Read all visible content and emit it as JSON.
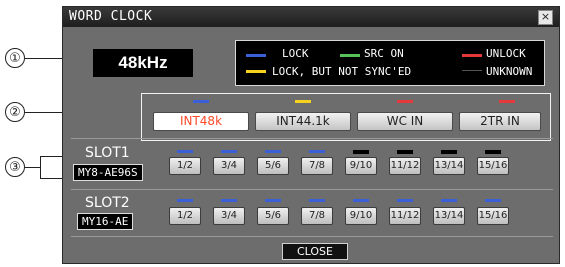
{
  "window": {
    "title": "WORD CLOCK",
    "close_glyph": "×"
  },
  "callouts": [
    "①",
    "②",
    "③"
  ],
  "frequency": "48kHz",
  "legend": [
    {
      "label": "LOCK",
      "color": "#3b5fd6"
    },
    {
      "label": "SRC ON",
      "color": "#57c25a"
    },
    {
      "label": "UNLOCK",
      "color": "#e5383b"
    },
    {
      "label": "LOCK, BUT NOT SYNC'ED",
      "color": "#f5d21f"
    },
    {
      "label": "UNKNOWN",
      "color": "#000000"
    }
  ],
  "sources": [
    {
      "label": "INT48k",
      "indicator": "#3b5fd6",
      "selected": true
    },
    {
      "label": "INT44.1k",
      "indicator": "#f5d21f",
      "selected": false
    },
    {
      "label": "WC IN",
      "indicator": "#e5383b",
      "selected": false
    },
    {
      "label": "2TR IN",
      "indicator": "#e5383b",
      "selected": false
    }
  ],
  "slots": [
    {
      "name": "SLOT1",
      "card": "MY8-AE96S",
      "channels": [
        {
          "label": "1/2",
          "indicator": "#3b5fd6"
        },
        {
          "label": "3/4",
          "indicator": "#3b5fd6"
        },
        {
          "label": "5/6",
          "indicator": "#3b5fd6"
        },
        {
          "label": "7/8",
          "indicator": "#3b5fd6"
        },
        {
          "label": "9/10",
          "indicator": "#000000"
        },
        {
          "label": "11/12",
          "indicator": "#000000"
        },
        {
          "label": "13/14",
          "indicator": "#000000"
        },
        {
          "label": "15/16",
          "indicator": "#000000"
        }
      ]
    },
    {
      "name": "SLOT2",
      "card": "MY16-AE",
      "channels": [
        {
          "label": "1/2",
          "indicator": "#3b5fd6"
        },
        {
          "label": "3/4",
          "indicator": "#3b5fd6"
        },
        {
          "label": "5/6",
          "indicator": "#3b5fd6"
        },
        {
          "label": "7/8",
          "indicator": "#3b5fd6"
        },
        {
          "label": "9/10",
          "indicator": "#3b5fd6"
        },
        {
          "label": "11/12",
          "indicator": "#3b5fd6"
        },
        {
          "label": "13/14",
          "indicator": "#3b5fd6"
        },
        {
          "label": "15/16",
          "indicator": "#3b5fd6"
        }
      ]
    }
  ],
  "close_label": "CLOSE"
}
